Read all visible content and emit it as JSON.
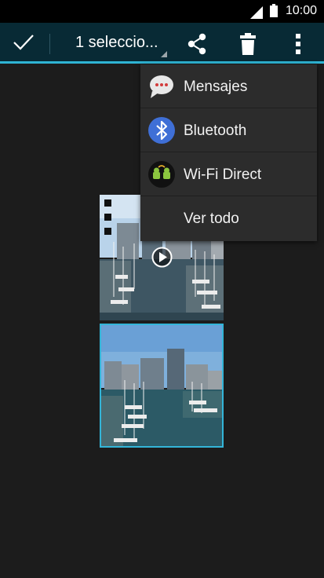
{
  "status_bar": {
    "time": "10:00"
  },
  "action_bar": {
    "selection_label": "1 seleccio...",
    "accent_color": "#2fb4d4",
    "background_color": "#082a35",
    "icons": [
      "check-icon",
      "share-icon",
      "trash-icon",
      "overflow-menu-icon"
    ]
  },
  "share_menu": {
    "items": [
      {
        "label": "Mensajes",
        "icon": "messages-icon"
      },
      {
        "label": "Bluetooth",
        "icon": "bluetooth-icon"
      },
      {
        "label": "Wi-Fi Direct",
        "icon": "wifi-direct-icon"
      },
      {
        "label": "Ver todo",
        "icon": ""
      }
    ]
  },
  "gallery": {
    "items": [
      {
        "type": "video",
        "selected": false
      },
      {
        "type": "photo",
        "selected": true
      }
    ],
    "selection_color": "#33b5d8"
  }
}
